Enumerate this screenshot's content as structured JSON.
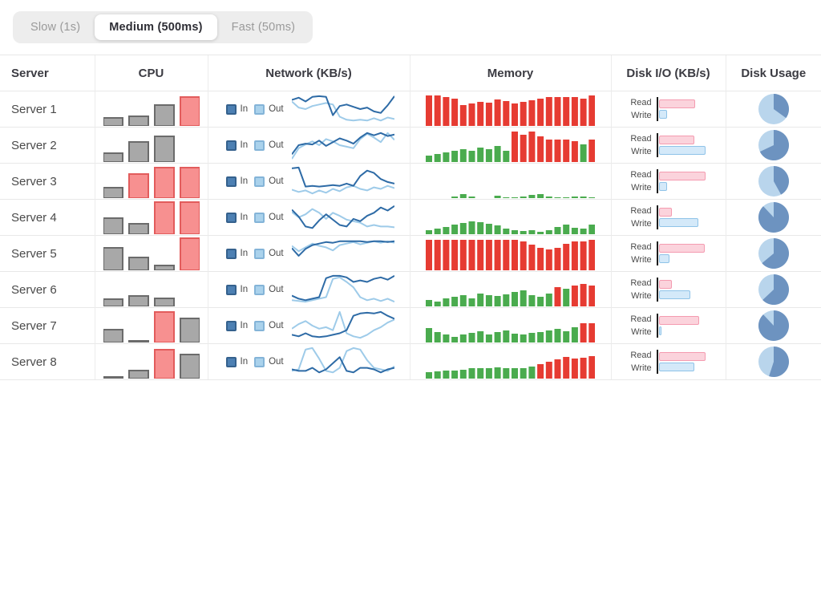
{
  "toggle": {
    "options": [
      {
        "label": "Slow (1s)",
        "active": false
      },
      {
        "label": "Medium (500ms)",
        "active": true
      },
      {
        "label": "Fast (50ms)",
        "active": false
      }
    ]
  },
  "table": {
    "columns": [
      "Server",
      "CPU",
      "Network (KB/s)",
      "Memory",
      "Disk I/O (KB/s)",
      "Disk Usage"
    ]
  },
  "legend": {
    "in": "In",
    "out": "Out",
    "read": "Read",
    "write": "Write"
  },
  "colors": {
    "cpu_gray_fill": "#a8a8a8",
    "cpu_gray_stroke": "#6b6b6b",
    "cpu_red_fill": "#f79090",
    "cpu_red_stroke": "#e25c5c",
    "net_in": "#2e6ba6",
    "net_out": "#9ecbe9",
    "mem_green": "#4aab4e",
    "mem_red": "#e63b32",
    "read_fill": "#fbd3dc",
    "read_stroke": "#f49bb0",
    "write_fill": "#d4e9f9",
    "write_stroke": "#8fc3e8",
    "pie_light": "#b9d5ec",
    "pie_dark": "#6d93c0"
  },
  "chart_scale": {
    "bar_max": 40,
    "line_max": 40
  },
  "servers": [
    {
      "name": "Server 1",
      "cpu": {
        "values": [
          10,
          12,
          26,
          36
        ],
        "colors": "gggr"
      },
      "network": {
        "in": [
          32,
          35,
          30,
          36,
          37,
          36,
          12,
          24,
          26,
          23,
          20,
          22,
          17,
          15,
          25,
          37
        ],
        "out": [
          30,
          22,
          20,
          24,
          26,
          28,
          26,
          10,
          6,
          5,
          6,
          5,
          8,
          5,
          9,
          7
        ]
      },
      "memory": {
        "values": [
          38,
          38,
          36,
          34,
          26,
          28,
          30,
          29,
          33,
          31,
          28,
          30,
          32,
          34,
          36,
          36,
          36,
          36,
          34,
          38
        ],
        "colors": "rrrrrrrrrrrrrrrrrrrr"
      },
      "disk_io": {
        "read": 0.78,
        "write": 0.18
      },
      "disk_usage_pct": 35
    },
    {
      "name": "Server 2",
      "cpu": {
        "values": [
          11,
          25,
          32,
          0
        ],
        "colors": "gggg"
      },
      "network": {
        "in": [
          8,
          20,
          22,
          21,
          26,
          19,
          24,
          29,
          26,
          22,
          30,
          36,
          33,
          36,
          32,
          34
        ],
        "out": [
          2,
          16,
          21,
          25,
          20,
          28,
          25,
          20,
          18,
          16,
          28,
          35,
          30,
          24,
          36,
          27
        ]
      },
      "memory": {
        "values": [
          8,
          10,
          12,
          14,
          16,
          14,
          18,
          16,
          20,
          14,
          38,
          34,
          38,
          32,
          28,
          28,
          28,
          26,
          22,
          28
        ],
        "colors": "ggggggggggrrrrrrrrgr"
      },
      "disk_io": {
        "read": 0.75,
        "write": 1.0
      },
      "disk_usage_pct": 68
    },
    {
      "name": "Server 3",
      "cpu": {
        "values": [
          13,
          30,
          38,
          38
        ],
        "colors": "grrr"
      },
      "network": {
        "in": [
          37,
          38,
          13,
          14,
          13,
          14,
          15,
          14,
          17,
          14,
          27,
          34,
          31,
          23,
          19,
          17
        ],
        "out": [
          9,
          6,
          8,
          4,
          8,
          5,
          10,
          7,
          12,
          14,
          10,
          8,
          12,
          10,
          14,
          11
        ]
      },
      "memory": {
        "values": [
          0,
          0,
          0,
          2,
          5,
          2,
          0,
          0,
          3,
          1,
          1,
          2,
          4,
          5,
          2,
          1,
          1,
          2,
          2,
          1
        ],
        "colors": "gggggggggggggggggggg"
      },
      "disk_io": {
        "read": 1.0,
        "write": 0.18
      },
      "disk_usage_pct": 42
    },
    {
      "name": "Server 4",
      "cpu": {
        "values": [
          20,
          13,
          40,
          40
        ],
        "colors": "ggrr"
      },
      "network": {
        "in": [
          30,
          21,
          8,
          6,
          16,
          24,
          17,
          10,
          8,
          18,
          15,
          22,
          26,
          33,
          29,
          35
        ],
        "out": [
          27,
          20,
          24,
          31,
          26,
          18,
          26,
          22,
          17,
          15,
          13,
          8,
          10,
          8,
          8,
          7
        ]
      },
      "memory": {
        "values": [
          5,
          7,
          9,
          12,
          14,
          16,
          15,
          13,
          11,
          7,
          5,
          4,
          5,
          3,
          5,
          9,
          12,
          8,
          7,
          12
        ],
        "colors": "gggggggggggggggggggg"
      },
      "disk_io": {
        "read": 0.28,
        "write": 0.85
      },
      "disk_usage_pct": 88
    },
    {
      "name": "Server 5",
      "cpu": {
        "values": [
          28,
          16,
          6,
          40
        ],
        "colors": "gggr"
      },
      "network": {
        "in": [
          27,
          17,
          26,
          31,
          33,
          35,
          34,
          36,
          36,
          36,
          36,
          35,
          36,
          36,
          35,
          36
        ],
        "out": [
          30,
          23,
          28,
          33,
          30,
          28,
          24,
          31,
          33,
          35,
          32,
          34,
          36,
          34,
          36,
          34
        ]
      },
      "memory": {
        "values": [
          38,
          38,
          38,
          38,
          38,
          38,
          38,
          38,
          38,
          38,
          38,
          36,
          32,
          28,
          26,
          28,
          33,
          36,
          36,
          38
        ],
        "colors": "rrrrrrrrrrrrrrrrrrrr"
      },
      "disk_io": {
        "read": 0.98,
        "write": 0.22
      },
      "disk_usage_pct": 64
    },
    {
      "name": "Server 6",
      "cpu": {
        "values": [
          9,
          13,
          10,
          0
        ],
        "colors": "gggg"
      },
      "network": {
        "in": [
          12,
          8,
          6,
          8,
          10,
          35,
          38,
          38,
          36,
          30,
          32,
          30,
          34,
          36,
          33,
          38
        ],
        "out": [
          6,
          5,
          4,
          6,
          8,
          10,
          34,
          36,
          30,
          23,
          10,
          6,
          8,
          5,
          8,
          4
        ]
      },
      "memory": {
        "values": [
          8,
          6,
          10,
          12,
          14,
          10,
          16,
          14,
          13,
          15,
          18,
          20,
          14,
          12,
          16,
          24,
          22,
          26,
          28,
          26
        ],
        "colors": "gggggggggggggggrgrrr"
      },
      "disk_io": {
        "read": 0.27,
        "write": 0.67
      },
      "disk_usage_pct": 63
    },
    {
      "name": "Server 7",
      "cpu": {
        "values": [
          16,
          2,
          38,
          30
        ],
        "colors": "ggrg"
      },
      "network": {
        "in": [
          8,
          6,
          10,
          6,
          5,
          6,
          8,
          10,
          14,
          33,
          36,
          37,
          36,
          38,
          33,
          29
        ],
        "out": [
          16,
          22,
          26,
          20,
          16,
          18,
          14,
          38,
          10,
          6,
          4,
          8,
          14,
          18,
          24,
          28
        ]
      },
      "memory": {
        "values": [
          18,
          13,
          10,
          7,
          10,
          12,
          14,
          10,
          13,
          15,
          11,
          10,
          12,
          13,
          15,
          17,
          14,
          19,
          24,
          24
        ],
        "colors": "ggggggggggggggggggrr"
      },
      "disk_io": {
        "read": 0.87,
        "write": 0.05
      },
      "disk_usage_pct": 88
    },
    {
      "name": "Server 8",
      "cpu": {
        "values": [
          2,
          10,
          36,
          30
        ],
        "colors": "ggrg"
      },
      "network": {
        "in": [
          10,
          8,
          8,
          12,
          6,
          10,
          18,
          26,
          8,
          6,
          12,
          12,
          10,
          6,
          10,
          12
        ],
        "out": [
          8,
          10,
          36,
          38,
          24,
          8,
          6,
          12,
          34,
          38,
          36,
          22,
          12,
          10,
          8,
          14
        ]
      },
      "memory": {
        "values": [
          8,
          9,
          10,
          10,
          11,
          13,
          13,
          13,
          14,
          13,
          13,
          13,
          15,
          18,
          21,
          24,
          27,
          25,
          26,
          28
        ],
        "colors": "gggggggggggggrrrrrrr"
      },
      "disk_io": {
        "read": 1.0,
        "write": 0.76
      },
      "disk_usage_pct": 55
    }
  ]
}
